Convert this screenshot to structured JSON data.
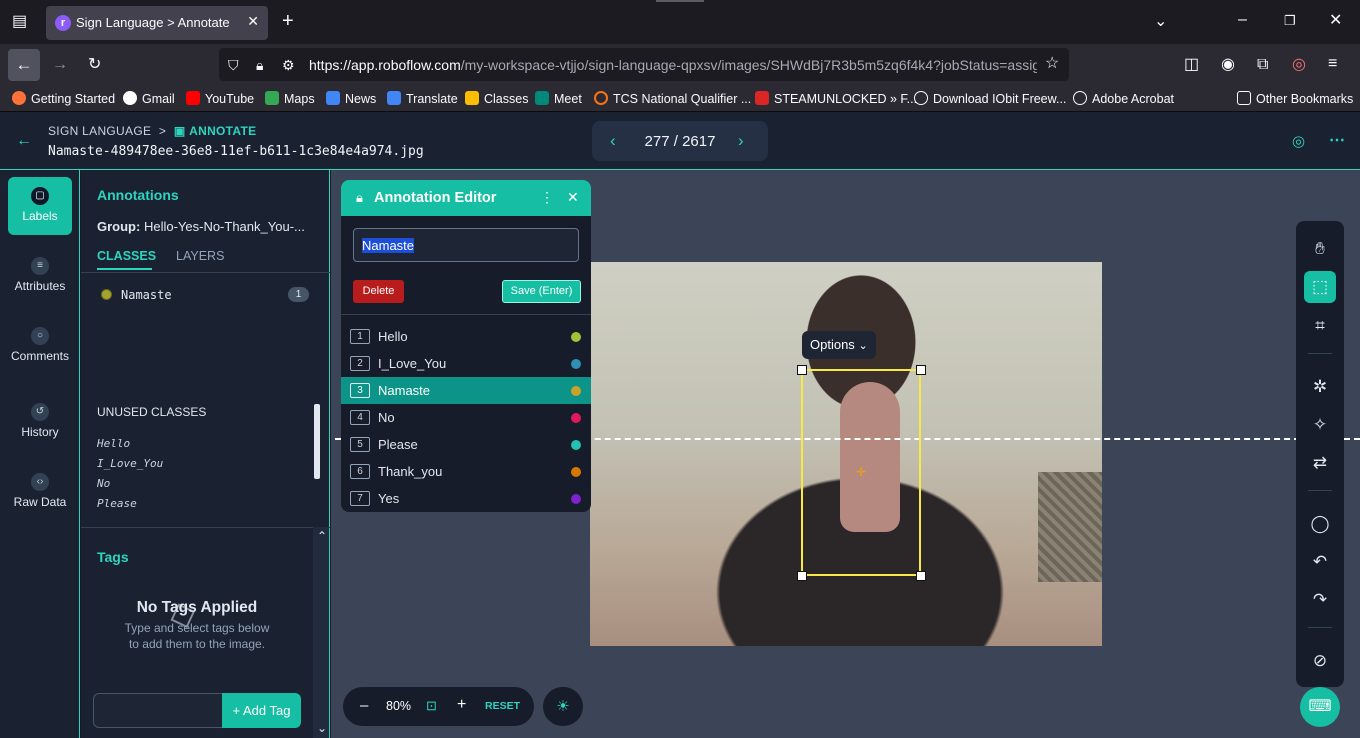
{
  "browser": {
    "tab_title": "Sign Language > Annotate",
    "url_main": "https://app.roboflow.com",
    "url_rest": "/my-workspace-vtjjo/sign-language-qpxsv/images/SHWdBj7R3b5m5zq6f4k4?jobStatus=assig",
    "bookmarks": [
      "Getting Started",
      "Gmail",
      "YouTube",
      "Maps",
      "News",
      "Translate",
      "Classes",
      "Meet",
      "TCS National Qualifier ...",
      "STEAMUNLOCKED » F...",
      "Download IObit Freew...",
      "Adobe Acrobat"
    ],
    "other_bookmarks": "Other Bookmarks"
  },
  "header": {
    "crumb_project": "SIGN LANGUAGE",
    "crumb_sep": ">",
    "crumb_active": "ANNOTATE",
    "filename": "Namaste-489478ee-36e8-11ef-b611-1c3e84e4a974.jpg",
    "pager": "277 / 2617"
  },
  "leftnav": [
    "Labels",
    "Attributes",
    "Comments",
    "History",
    "Raw Data"
  ],
  "panel": {
    "title": "Annotations",
    "group_label": "Group:",
    "group_value": "Hello-Yes-No-Thank_You-...",
    "tab_classes": "CLASSES",
    "tab_layers": "LAYERS",
    "used_class": "Namaste",
    "used_count": "1",
    "unused_title": "UNUSED CLASSES",
    "unused": [
      "Hello",
      "I_Love_You",
      "No",
      "Please"
    ],
    "tags_title": "Tags",
    "no_tags": "No Tags Applied",
    "no_tags_sub1": "Type and select tags below",
    "no_tags_sub2": "to add them to the image.",
    "add_tag": "+ Add Tag"
  },
  "editor": {
    "title": "Annotation Editor",
    "input_value": "Namaste",
    "delete": "Delete",
    "save": "Save (Enter)",
    "classes": [
      {
        "num": "1",
        "name": "Hello",
        "color": "#a3c23a"
      },
      {
        "num": "2",
        "name": "I_Love_You",
        "color": "#2f8fb4"
      },
      {
        "num": "3",
        "name": "Namaste",
        "color": "#c9a227"
      },
      {
        "num": "4",
        "name": "No",
        "color": "#e0195e"
      },
      {
        "num": "5",
        "name": "Please",
        "color": "#22c1b0"
      },
      {
        "num": "6",
        "name": "Thank_you",
        "color": "#d97706"
      },
      {
        "num": "7",
        "name": "Yes",
        "color": "#7e22ce"
      }
    ]
  },
  "canvas": {
    "options_label": "Options",
    "zoom": "80%",
    "reset": "RESET",
    "box_color": "#f7e94a"
  }
}
